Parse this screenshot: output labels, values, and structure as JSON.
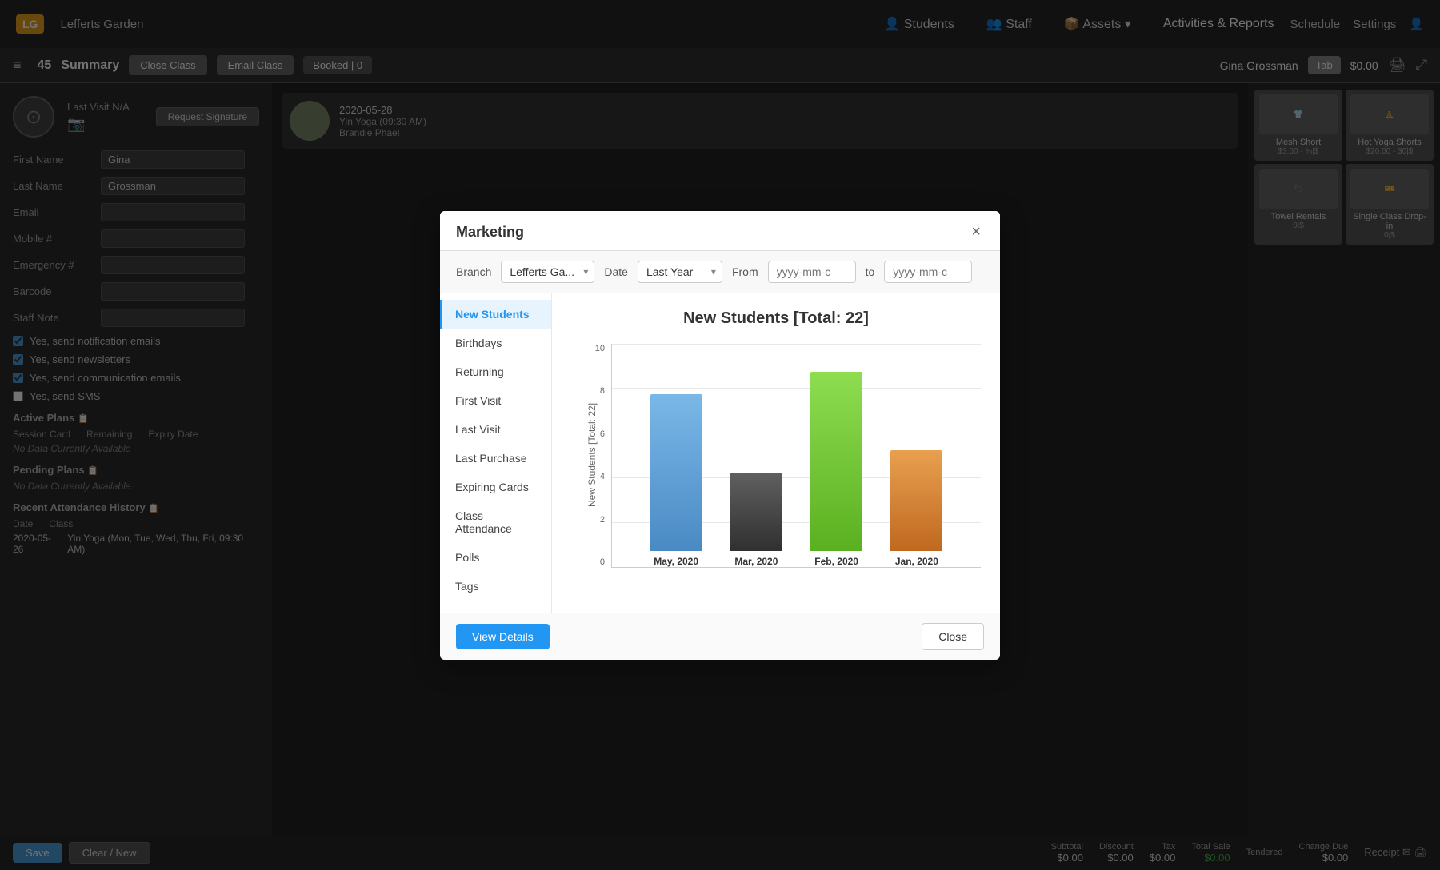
{
  "app": {
    "brand": "LG",
    "brand_name": "Lefferts Garden",
    "nav_items": [
      "Students",
      "Staff",
      "Assets",
      "Activities & Reports"
    ],
    "schedule_label": "Schedule",
    "settings_label": "Settings"
  },
  "toolbar": {
    "hamburger": "≡",
    "count": "45",
    "summary_label": "Summary",
    "close_class_label": "Close Class",
    "email_class_label": "Email Class",
    "booked_label": "Booked | 0",
    "user_name": "Gina Grossman",
    "tab_label": "Tab",
    "amount": "$0.00"
  },
  "left_panel": {
    "last_visit_label": "Last Visit",
    "last_visit_value": "N/A",
    "first_name_label": "First Name",
    "first_name_value": "Gina",
    "last_name_label": "Last Name",
    "last_name_value": "Grossman",
    "email_label": "Email",
    "mobile_label": "Mobile #",
    "emergency_label": "Emergency #",
    "barcode_label": "Barcode",
    "staff_note_label": "Staff Note",
    "req_sig_label": "Request Signature",
    "checkboxes": [
      "Yes, send notification emails",
      "Yes, send newsletters",
      "Yes, send communication emails",
      "Yes, send SMS"
    ],
    "active_plans_label": "Active Plans",
    "session_card_label": "Session Card",
    "remaining_label": "Remaining",
    "expiry_label": "Expiry Date",
    "no_data": "No Data Currently Available",
    "pending_plans_label": "Pending Plans",
    "recent_attendance_label": "Recent Attendance History",
    "date_col": "Date",
    "class_col": "Class",
    "attendance_row": {
      "date": "2020-05-26",
      "class": "Yin Yoga (Mon, Tue, Wed, Thu, Fri, 09:30 AM)"
    }
  },
  "modal": {
    "title": "Marketing",
    "close_symbol": "×",
    "branch_label": "Branch",
    "branch_value": "Lefferts Ga...",
    "date_label": "Date",
    "date_value": "Last Year",
    "from_label": "From",
    "from_placeholder": "yyyy-mm-c",
    "to_label": "to",
    "to_placeholder": "yyyy-mm-c",
    "menu_items": [
      {
        "label": "New Students",
        "active": true
      },
      {
        "label": "Birthdays",
        "active": false
      },
      {
        "label": "Returning",
        "active": false
      },
      {
        "label": "First Visit",
        "active": false
      },
      {
        "label": "Last Visit",
        "active": false
      },
      {
        "label": "Last Purchase",
        "active": false
      },
      {
        "label": "Expiring Cards",
        "active": false
      },
      {
        "label": "Class Attendance",
        "active": false
      },
      {
        "label": "Polls",
        "active": false
      },
      {
        "label": "Tags",
        "active": false
      }
    ],
    "chart_title": "New Students [Total: 22]",
    "y_axis_label": "New Students [Total: 22]",
    "y_labels": [
      "10",
      "8",
      "6",
      "4",
      "2",
      "0"
    ],
    "bars": [
      {
        "label": "May, 2020",
        "value": 7,
        "color": "#5b9bd5",
        "height_pct": 70
      },
      {
        "label": "Mar, 2020",
        "value": 3.5,
        "color": "#404040",
        "height_pct": 35
      },
      {
        "label": "Feb, 2020",
        "value": 8,
        "color": "#70c040",
        "height_pct": 80
      },
      {
        "label": "Jan, 2020",
        "value": 4.5,
        "color": "#d4813a",
        "height_pct": 45
      }
    ],
    "view_details_label": "View Details",
    "close_label": "Close"
  },
  "bottom": {
    "save_label": "Save",
    "clear_new_label": "Clear / New",
    "subtotal_label": "Subtotal",
    "subtotal_val": "$0.00",
    "discount_label": "Discount",
    "discount_val": "$0.00",
    "tax_label": "Tax",
    "tax_val": "$0.00",
    "total_label": "Total Sale",
    "total_val": "$0.00",
    "tendered_label": "Tendered",
    "change_label": "Change Due",
    "change_val": "$0.00",
    "receipt_label": "Receipt"
  }
}
